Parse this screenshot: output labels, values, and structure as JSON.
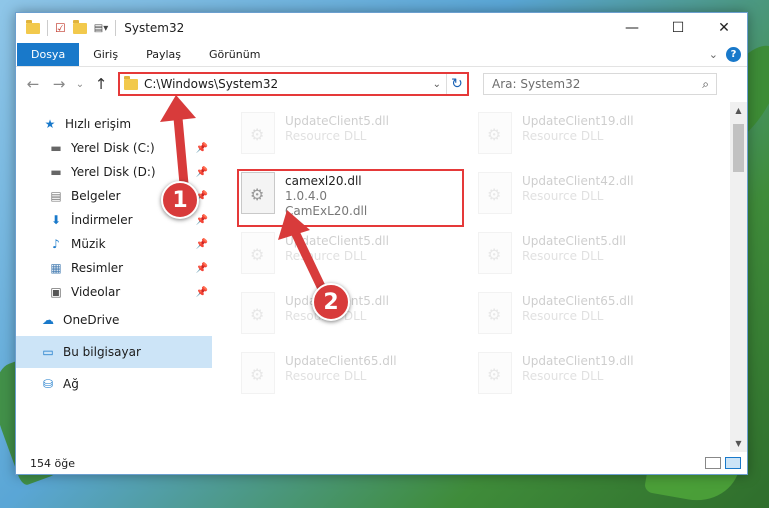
{
  "titlebar": {
    "title": "System32",
    "minimize": "—",
    "maximize": "☐",
    "close": "✕"
  },
  "ribbon": {
    "tabs": [
      "Dosya",
      "Giriş",
      "Paylaş",
      "Görünüm"
    ],
    "expand": "⌄",
    "help": "?"
  },
  "address": {
    "path": "C:\\Windows\\System32",
    "refresh": "↻",
    "dropdown": "⌄"
  },
  "search": {
    "placeholder": "Ara: System32",
    "icon": "⌕"
  },
  "nav": {
    "back": "←",
    "forward": "→",
    "recent": "⌄",
    "up": "↑",
    "items": [
      {
        "label": "Hızlı erişim",
        "icon": "star-icon",
        "glyph": "★"
      },
      {
        "label": "Yerel Disk (C:)",
        "icon": "drive-icon",
        "glyph": "▬"
      },
      {
        "label": "Yerel Disk (D:)",
        "icon": "drive-icon",
        "glyph": "▬"
      },
      {
        "label": "Belgeler",
        "icon": "document-icon",
        "glyph": "▤"
      },
      {
        "label": "İndirmeler",
        "icon": "download-icon",
        "glyph": "⬇"
      },
      {
        "label": "Müzik",
        "icon": "music-icon",
        "glyph": "♪"
      },
      {
        "label": "Resimler",
        "icon": "pictures-icon",
        "glyph": "▦"
      },
      {
        "label": "Videolar",
        "icon": "video-icon",
        "glyph": "▣"
      },
      {
        "label": "OneDrive",
        "icon": "cloud-icon",
        "glyph": "☁"
      },
      {
        "label": "Bu bilgisayar",
        "icon": "computer-icon",
        "glyph": "▭"
      },
      {
        "label": "Ağ",
        "icon": "network-icon",
        "glyph": "⛁"
      }
    ],
    "pin": "📌"
  },
  "files": [
    {
      "name": "UpdateClient5.dll",
      "type": "Resource DLL"
    },
    {
      "name": "UpdateClient19.dll",
      "type": "Resource DLL"
    },
    {
      "name": "camexl20.dll",
      "version": "1.0.4.0",
      "desc": "CamExL20.dll"
    },
    {
      "name": "UpdateClient42.dll",
      "type": "Resource DLL"
    },
    {
      "name": "UpdateClient5.dll",
      "type": "Resource DLL"
    },
    {
      "name": "UpdateClient5.dll",
      "type": "Resource DLL"
    },
    {
      "name": "UpdateClient5.dll",
      "type": "Resource DLL"
    },
    {
      "name": "UpdateClient65.dll",
      "type": "Resource DLL"
    },
    {
      "name": "UpdateClient65.dll",
      "type": "Resource DLL"
    },
    {
      "name": "UpdateClient19.dll",
      "type": "Resource DLL"
    }
  ],
  "status": {
    "count": "154 öğe"
  },
  "callouts": [
    "1",
    "2"
  ],
  "colors": {
    "accent": "#1979ca",
    "highlight": "#e53939"
  }
}
